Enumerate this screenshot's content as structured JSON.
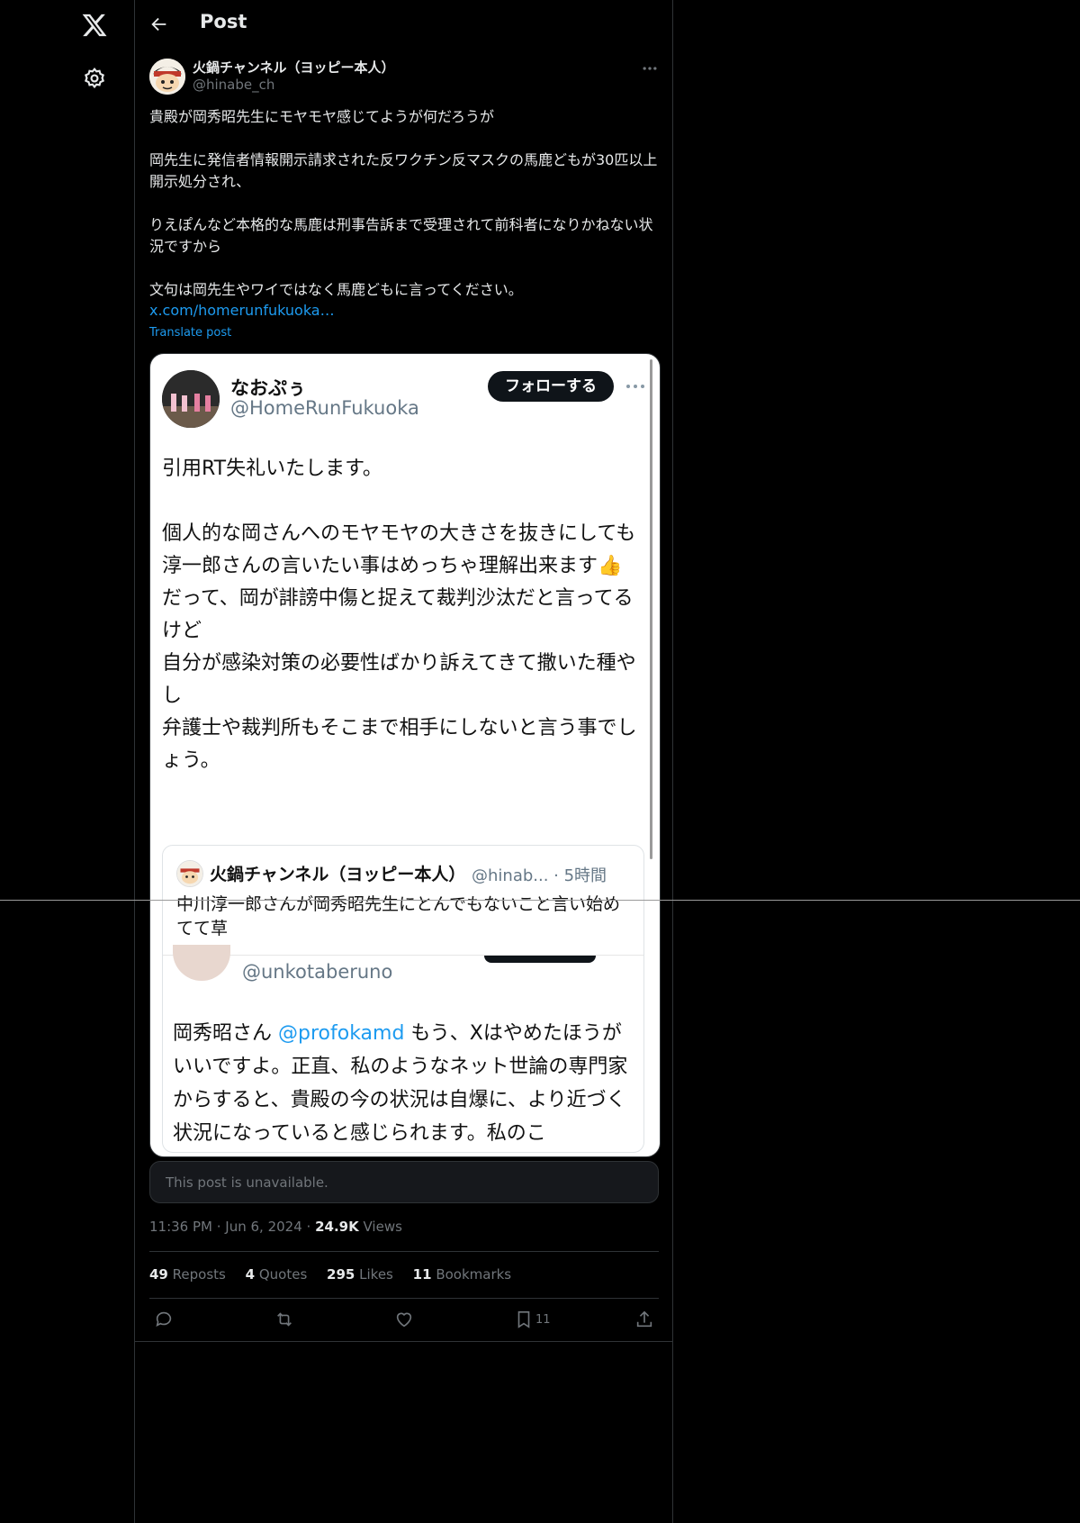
{
  "header": {
    "title": "Post"
  },
  "post": {
    "display_name": "火鍋チャンネル（ヨッピー本人）",
    "handle": "@hinabe_ch",
    "body": "貴殿が岡秀昭先生にモヤモヤ感じてようが何だろうが\n\n岡先生に発信者情報開示請求された反ワクチン反マスクの馬鹿どもが30匹以上開示処分され、\n\nりえぽんなど本格的な馬鹿は刑事告訴まで受理されて前科者になりかねない状況ですから\n\n文句は岡先生やワイではなく馬鹿どもに言ってください。",
    "link": "x.com/homerunfukuoka…",
    "translate": "Translate post",
    "unavailable": "This post is unavailable.",
    "time": "11:36 PM",
    "date": "Jun 6, 2024",
    "views_count": "24.9K",
    "views_label": "Views"
  },
  "screenshot": {
    "name": "なおぷぅ",
    "handle": "@HomeRunFukuoka",
    "follow": "フォローする",
    "text": "引用RT失礼いたします。\n\n個人的な岡さんへのモヤモヤの大きさを抜きにしても\n淳一郎さんの言いたい事はめっちゃ理解出来ます👍\nだって、岡が誹謗中傷と捉えて裁判沙汰だと言ってるけど\n自分が感染対策の必要性ばかり訴えてきて撒いた種やし\n弁護士や裁判所もそこまで相手にしないと言う事でしょう。",
    "nested_name": "火鍋チャンネル（ヨッピー本人）",
    "nested_handle": "@hinab... · 5時間",
    "nested_text": "中川淳一郎さんが岡秀昭先生にとんでもないこと言い始めてて草",
    "inner_handle": "@unkotaberuno",
    "inner_pre": "岡秀昭さん ",
    "inner_mention": "@profokamd",
    "inner_post": " もう、Xはやめたほうがいいですよ。正直、私のようなネット世論の専門家からすると、貴殿の今の状況は自爆に、より近づく状況になっていると感じられます。私のこ"
  },
  "stats": [
    {
      "count": "49",
      "label": "Reposts"
    },
    {
      "count": "4",
      "label": "Quotes"
    },
    {
      "count": "295",
      "label": "Likes"
    },
    {
      "count": "11",
      "label": "Bookmarks"
    }
  ],
  "actions": {
    "bookmark_count": "11"
  },
  "icons": [
    "x-logo-icon",
    "settings-icon",
    "back-arrow-icon",
    "more-icon",
    "reply-icon",
    "repost-icon",
    "like-icon",
    "bookmark-icon",
    "share-icon"
  ]
}
